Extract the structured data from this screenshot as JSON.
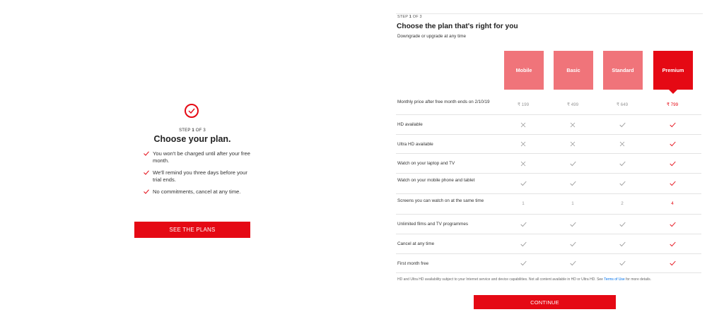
{
  "left_panel": {
    "step_prefix": "STEP ",
    "step_current": "1",
    "step_suffix": " OF 3",
    "title": "Choose your plan.",
    "benefits": [
      "You won't be charged until after your free month.",
      "We'll remind you three days before your trial ends.",
      "No commitments, cancel at any time."
    ],
    "button_label": "SEE THE PLANS"
  },
  "right_panel": {
    "step_prefix": "STEP ",
    "step_current": "1",
    "step_suffix": " OF 3",
    "title": "Choose the plan that's right for you",
    "subtitle": "Downgrade or upgrade at any time",
    "plans": [
      "Mobile",
      "Basic",
      "Standard",
      "Premium"
    ],
    "selected_plan": "Premium",
    "features": [
      {
        "label": "Monthly price after free month ends on 2/10/19",
        "type": "text",
        "values": [
          "₹ 199",
          "₹ 499",
          "₹ 649",
          "₹ 799"
        ]
      },
      {
        "label": "HD available",
        "type": "icon",
        "values": [
          "cross",
          "cross",
          "check",
          "check"
        ]
      },
      {
        "label": "Ultra HD available",
        "type": "icon",
        "values": [
          "cross",
          "cross",
          "cross",
          "check"
        ]
      },
      {
        "label": "Watch on your laptop and TV",
        "type": "icon",
        "values": [
          "cross",
          "check",
          "check",
          "check"
        ]
      },
      {
        "label": "Watch on your mobile phone and tablet",
        "type": "icon",
        "values": [
          "check",
          "check",
          "check",
          "check"
        ]
      },
      {
        "label": "Screens you can watch on at the same time",
        "type": "text",
        "values": [
          "1",
          "1",
          "2",
          "4"
        ]
      },
      {
        "label": "Unlimited films and TV programmes",
        "type": "icon",
        "values": [
          "check",
          "check",
          "check",
          "check"
        ]
      },
      {
        "label": "Cancel at any time",
        "type": "icon",
        "values": [
          "check",
          "check",
          "check",
          "check"
        ]
      },
      {
        "label": "First month free",
        "type": "icon",
        "values": [
          "check",
          "check",
          "check",
          "check"
        ]
      }
    ],
    "disclaimer_text": "HD and Ultra HD availability subject to your Internet service and device capabilities. Not all content available in HD or Ultra HD. See ",
    "terms_link": "Terms of Use",
    "disclaimer_end": " for more details.",
    "continue_label": "CONTINUE"
  },
  "colors": {
    "brand_red": "#e50914",
    "unselected_plan": "#f0747a",
    "muted_icon": "#999999"
  }
}
